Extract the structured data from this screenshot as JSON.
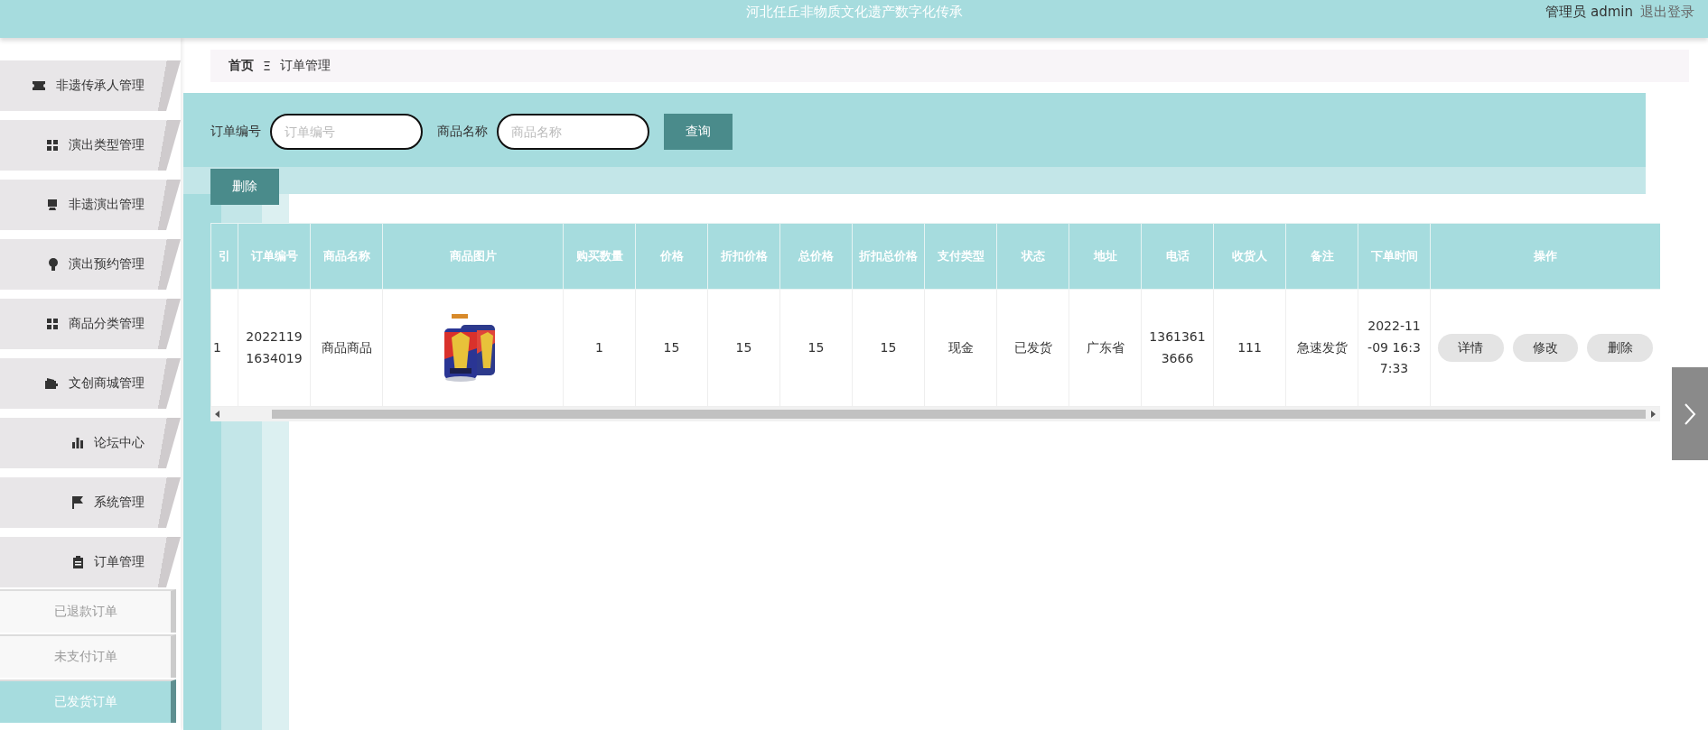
{
  "header": {
    "title": "河北任丘非物质文化遗产数字化传承",
    "user": "管理员 admin",
    "logout": "退出登录"
  },
  "sidebar": {
    "items": [
      {
        "label": "非遗传承人管理"
      },
      {
        "label": "演出类型管理"
      },
      {
        "label": "非遗演出管理"
      },
      {
        "label": "演出预约管理"
      },
      {
        "label": "商品分类管理"
      },
      {
        "label": "文创商城管理"
      },
      {
        "label": "论坛中心"
      },
      {
        "label": "系统管理"
      },
      {
        "label": "订单管理",
        "children": [
          {
            "label": "已退款订单",
            "selected": false
          },
          {
            "label": "未支付订单",
            "selected": false
          },
          {
            "label": "已发货订单",
            "selected": true
          }
        ]
      }
    ]
  },
  "breadcrumb": {
    "home": "首页",
    "separator": "Ξ",
    "current": "订单管理"
  },
  "search": {
    "fields": [
      {
        "label": "订单编号",
        "placeholder": "订单编号"
      },
      {
        "label": "商品名称",
        "placeholder": "商品名称"
      }
    ],
    "button": "查询"
  },
  "delete_button": "删除",
  "table": {
    "columns": [
      "引",
      "订单编号",
      "商品名称",
      "商品图片",
      "购买数量",
      "价格",
      "折扣价格",
      "总价格",
      "折扣总价格",
      "支付类型",
      "状态",
      "地址",
      "电话",
      "收货人",
      "备注",
      "下单时间",
      "操作"
    ],
    "rows": [
      {
        "cells": [
          {
            "kind": "text",
            "text": "1"
          },
          {
            "kind": "text",
            "text": "20221191634019"
          },
          {
            "kind": "text",
            "text": "商品商品"
          },
          {
            "kind": "picture"
          },
          {
            "kind": "text",
            "text": "1"
          },
          {
            "kind": "text",
            "text": "15"
          },
          {
            "kind": "text",
            "text": "15"
          },
          {
            "kind": "text",
            "text": "15"
          },
          {
            "kind": "text",
            "text": "15"
          },
          {
            "kind": "text",
            "text": "现金"
          },
          {
            "kind": "text",
            "text": "已发货"
          },
          {
            "kind": "text",
            "text": "广东省"
          },
          {
            "kind": "text",
            "text": "13613613666"
          },
          {
            "kind": "text",
            "text": "111"
          },
          {
            "kind": "text",
            "text": "急速发货"
          },
          {
            "kind": "text",
            "text": "2022-11-09 16:37:33"
          },
          {
            "kind": "actions",
            "buttons": [
              "详情",
              "修改",
              "删除"
            ]
          }
        ]
      }
    ]
  }
}
